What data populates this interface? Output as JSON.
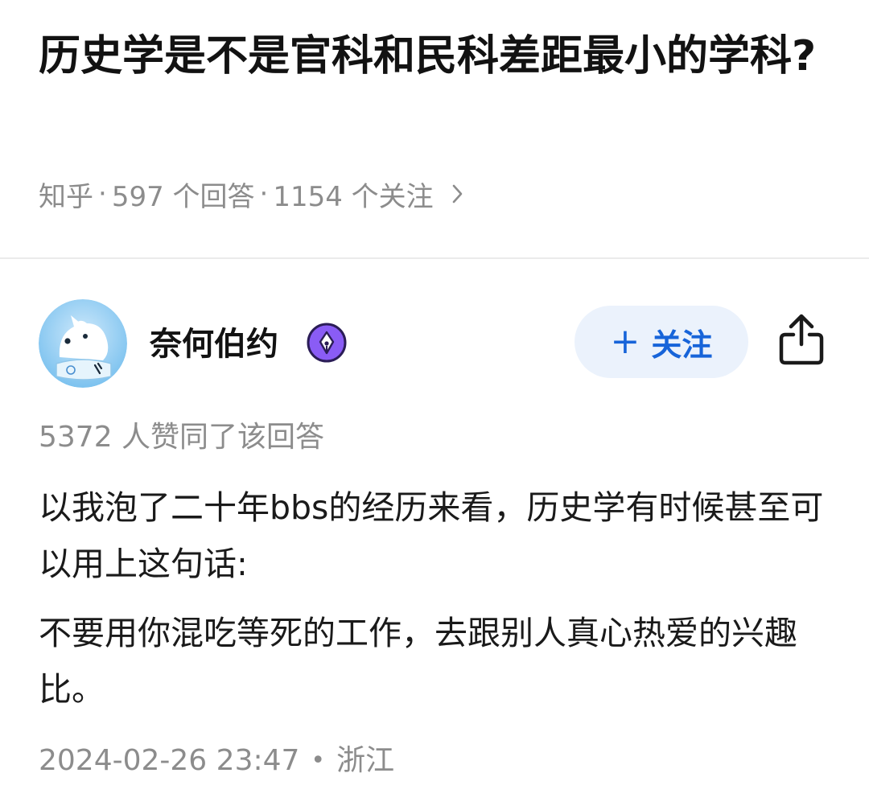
{
  "question": {
    "title": "历史学是不是官科和民科差距最小的学科?",
    "source": "知乎",
    "answer_count": "597 个回答",
    "follower_count": "1154 个关注",
    "separator": "·",
    "chevron_icon": "chevron-right-icon"
  },
  "answer": {
    "author": {
      "name": "奈何伯约",
      "avatar_icon": "avatar-icon",
      "badge_icon": "pen-badge-icon",
      "badge_color": "#8a5cf5"
    },
    "follow_button": {
      "plus": "+",
      "label": "关注",
      "text_color": "#1764d9",
      "bg_color": "#ebf2fc"
    },
    "share_icon": "share-icon",
    "vote_text": "5372 人赞同了该回答",
    "paragraphs": [
      "以我泡了二十年bbs的经历来看，历史学有时候甚至可以用上这句话:",
      "不要用你混吃等死的工作，去跟别人真心热爱的兴趣比。"
    ],
    "date": "2024-02-26 23:47",
    "footer_separator": "•",
    "location": "浙江"
  }
}
